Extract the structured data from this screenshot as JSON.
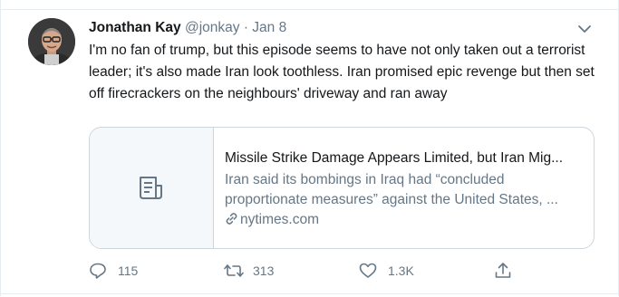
{
  "tweet": {
    "author_name": "Jonathan Kay",
    "author_handle": "@jonkay",
    "separator": "·",
    "date": "Jan 8",
    "text": "I'm no fan of trump, but this episode seems to have not only taken out a terrorist leader; it's also made Iran look toothless. Iran promised epic revenge but then set off firecrackers on the neighbours' driveway and ran away",
    "card": {
      "title": "Missile Strike Damage Appears Limited, but Iran Mig...",
      "description": "Iran said its bombings in Iraq had “concluded proportionate measures” against the United States, ...",
      "link": "nytimes.com",
      "thumbnail_icon": "article-icon"
    },
    "actions": {
      "reply_count": "115",
      "retweet_count": "313",
      "like_count": "1.3K"
    }
  },
  "icons": {
    "reply": "reply-icon",
    "retweet": "retweet-icon",
    "like": "heart-icon",
    "share": "share-icon",
    "more": "chevron-down-icon",
    "link": "link-icon"
  },
  "colors": {
    "text": "#14171a",
    "secondary": "#657786",
    "border": "#ccd6dd",
    "card_thumb_bg": "#f5f8fa"
  }
}
